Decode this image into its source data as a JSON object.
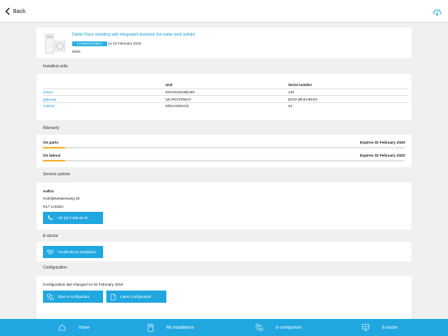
{
  "header": {
    "back_label": "Back"
  },
  "unit": {
    "title": "Daikin Floor standing with integrated domestic hot water tank (white)",
    "status": "COMMISSIONED",
    "date": "on 02 February 2018",
    "owner": "Meile"
  },
  "installed": {
    "title": "Installed units",
    "columns": [
      "",
      "Unit",
      "Serial number"
    ],
    "rows": [
      {
        "name": "indoor",
        "unit": "EHVH04S18DA6V",
        "serial": "123"
      },
      {
        "name": "gateway",
        "unit": "UK.RGATEWAY",
        "serial": "00:0A:59:04:99:9A"
      },
      {
        "name": "outdoor",
        "unit": "ERGA04DAV3",
        "serial": "24"
      }
    ]
  },
  "warranty": {
    "title": "Warranty",
    "parts_label": "On parts",
    "parts_expiry": "Expires 02 February 2020",
    "parts_progress": 0.06,
    "labour_label": "On labour",
    "labour_expiry": "Expires 02 February 2020",
    "labour_progress": 0.06
  },
  "partner": {
    "title": "Service partner",
    "name": "Aaltra",
    "address1": "Kortrijksesteenweg 40",
    "address2": "N17 London",
    "phone": "+32 (0) 9 395 08 87"
  },
  "edoctor": {
    "title": "E-doctor",
    "troubleshoot_label": "Troubleshoot installation"
  },
  "configuration": {
    "title": "Configuration",
    "last_changed": "Configuration last changed on 02 February 2018",
    "open_label": "Open e-configurator",
    "latest_label": "Latest configuration"
  },
  "bottom_nav": {
    "home": "Home",
    "installations": "My installations",
    "configurator": "E-configurator",
    "doctor": "E-doctor"
  },
  "colors": {
    "accent": "#20a7e0",
    "link": "#1aa1d6",
    "warranty_bar": "#f3b233"
  }
}
